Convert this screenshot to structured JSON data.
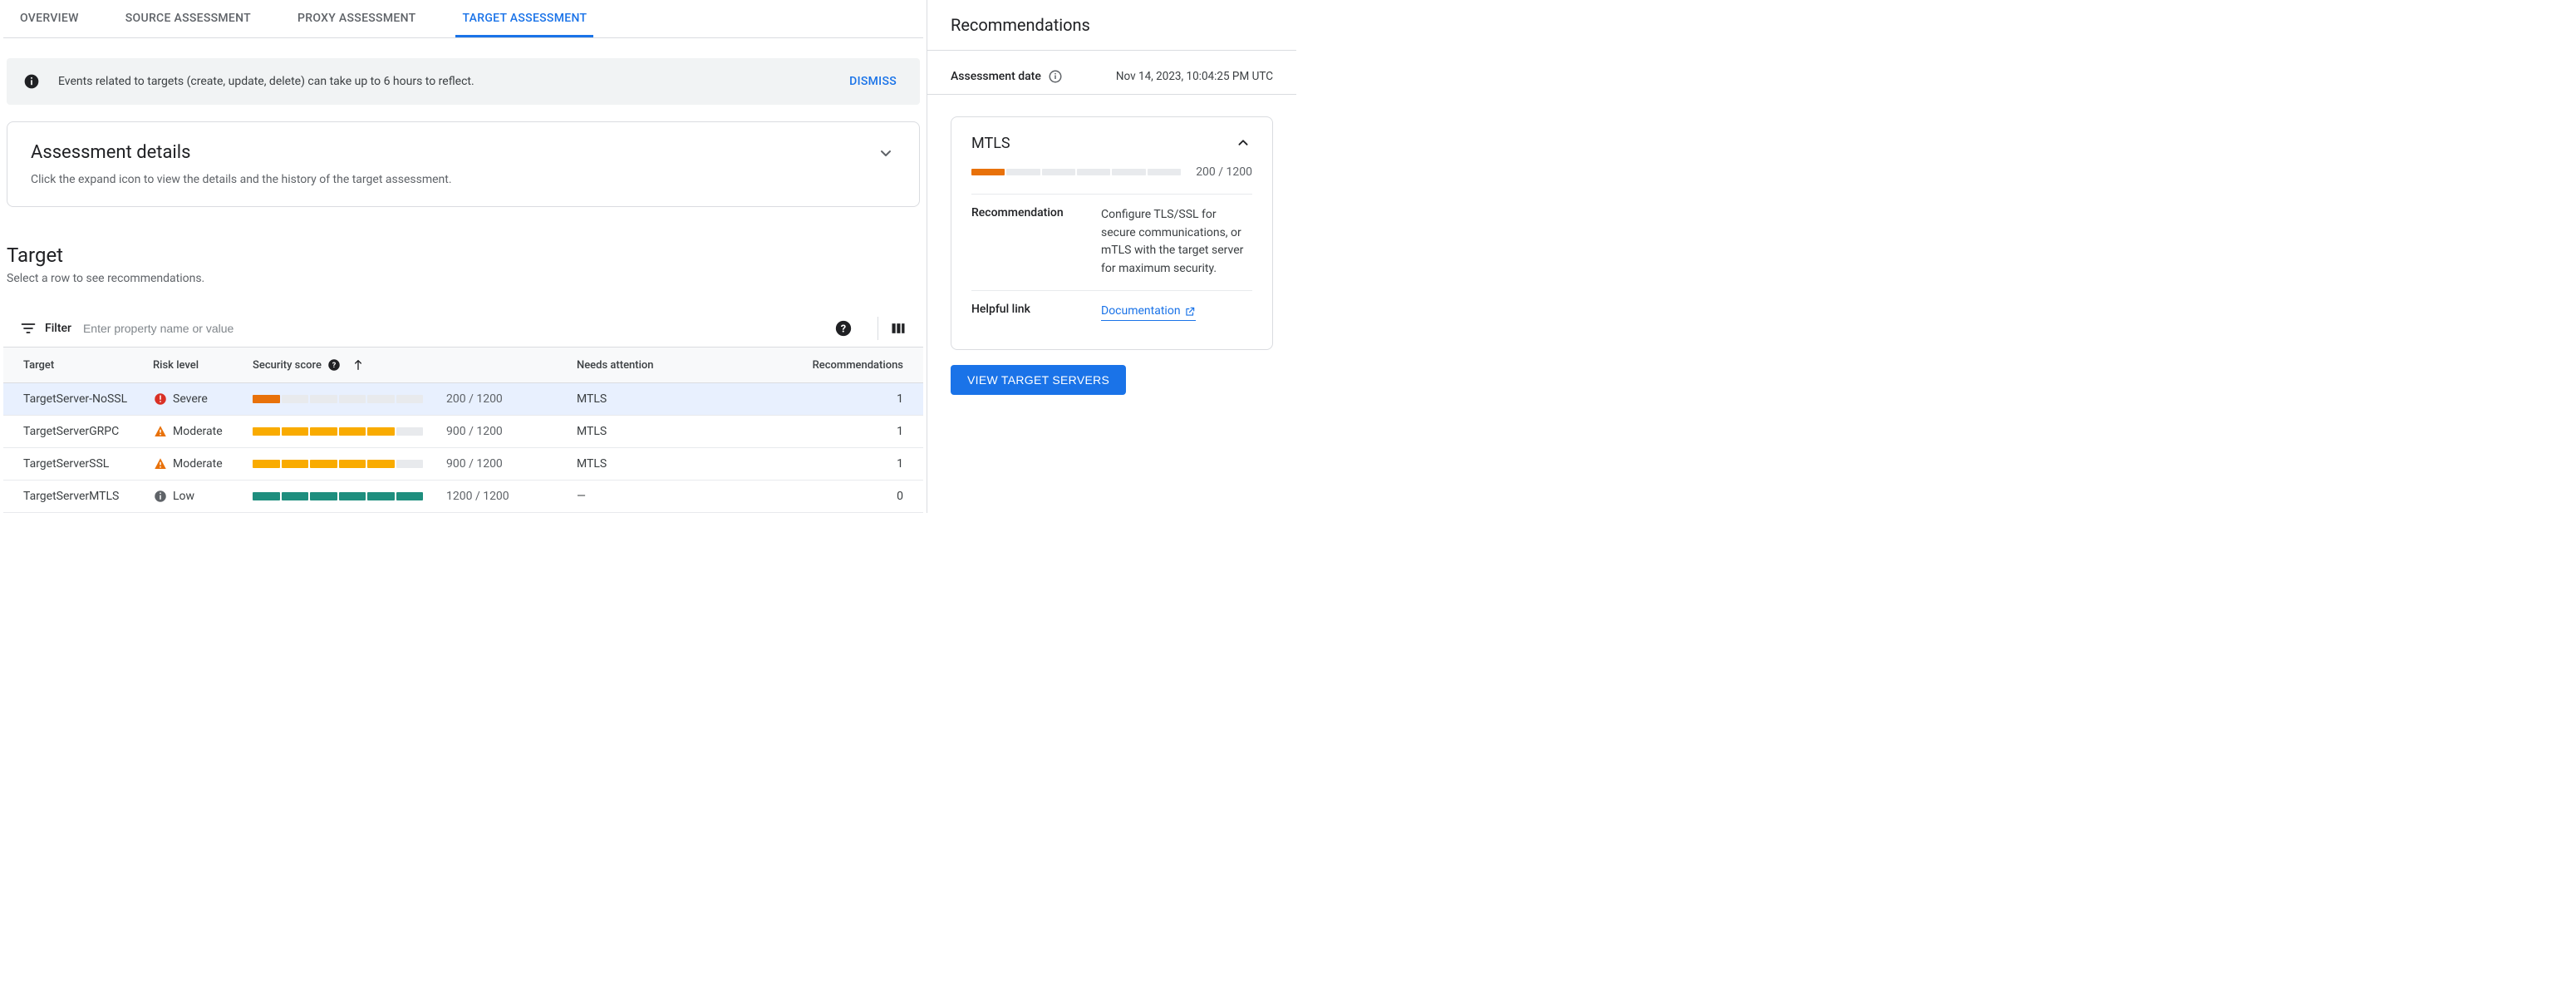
{
  "tabs": [
    "OVERVIEW",
    "SOURCE ASSESSMENT",
    "PROXY ASSESSMENT",
    "TARGET ASSESSMENT"
  ],
  "activeTab": 3,
  "banner": {
    "text": "Events related to targets (create, update, delete) can take up to 6 hours to reflect.",
    "dismiss": "DISMISS"
  },
  "details": {
    "title": "Assessment details",
    "subtitle": "Click the expand icon to view the details and the history of the target assessment."
  },
  "targetSection": {
    "title": "Target",
    "subtitle": "Select a row to see recommendations."
  },
  "filter": {
    "label": "Filter",
    "placeholder": "Enter property name or value"
  },
  "table": {
    "headers": {
      "target": "Target",
      "risk": "Risk level",
      "score": "Security score",
      "needs": "Needs attention",
      "rec": "Recommendations"
    },
    "rows": [
      {
        "target": "TargetServer-NoSSL",
        "risk": "Severe",
        "riskType": "severe",
        "score": "200 / 1200",
        "filled": 1,
        "color": "orange",
        "needs": "MTLS",
        "rec": "1",
        "selected": true
      },
      {
        "target": "TargetServerGRPC",
        "risk": "Moderate",
        "riskType": "moderate",
        "score": "900 / 1200",
        "filled": 5,
        "color": "amber",
        "needs": "MTLS",
        "rec": "1",
        "selected": false
      },
      {
        "target": "TargetServerSSL",
        "risk": "Moderate",
        "riskType": "moderate",
        "score": "900 / 1200",
        "filled": 5,
        "color": "amber",
        "needs": "MTLS",
        "rec": "1",
        "selected": false
      },
      {
        "target": "TargetServerMTLS",
        "risk": "Low",
        "riskType": "low",
        "score": "1200 / 1200",
        "filled": 6,
        "color": "teal",
        "needs": "—",
        "rec": "0",
        "selected": false
      }
    ]
  },
  "sidebar": {
    "heading": "Recommendations",
    "dateLabel": "Assessment date",
    "dateValue": "Nov 14, 2023, 10:04:25 PM UTC",
    "card": {
      "title": "MTLS",
      "score": "200 / 1200",
      "recommendationLabel": "Recommendation",
      "recommendationText": "Configure TLS/SSL for secure communications, or mTLS with the target server for maximum security.",
      "linkLabel": "Helpful link",
      "linkText": "Documentation"
    },
    "button": "VIEW TARGET SERVERS"
  }
}
